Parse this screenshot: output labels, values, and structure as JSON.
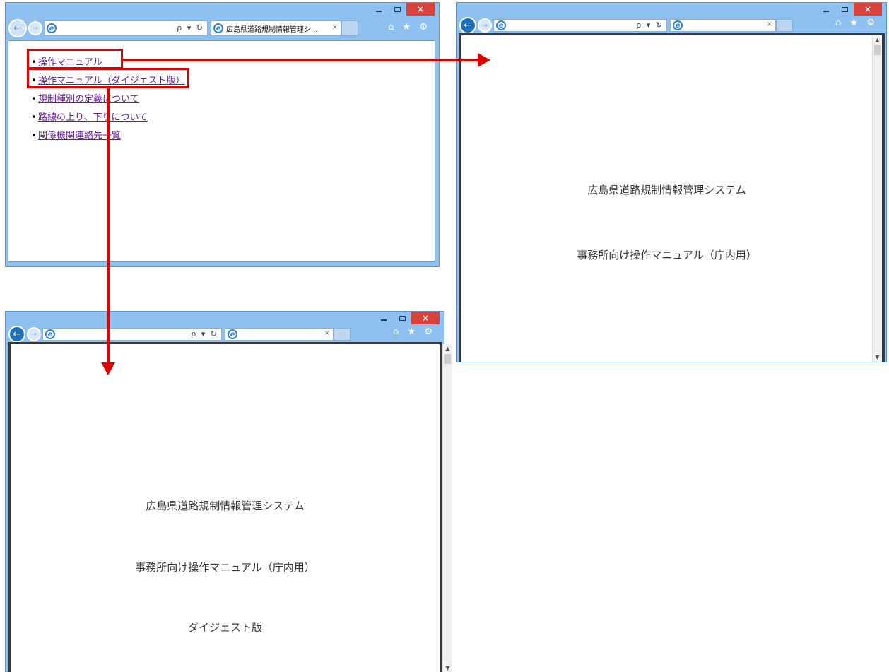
{
  "browser_main": {
    "tab_title": "広島県道路規制情報管理シ...",
    "tab_close": "×",
    "search_refresh": "ρ ▾ ↻",
    "links": [
      "操作マニュアル",
      "操作マニュアル（ダイジェスト版）",
      "規制種別の定義について",
      "路線の上り、下りについて",
      "関係機関連絡先一覧"
    ]
  },
  "browser_manual": {
    "tab_close": "×",
    "search_refresh": "ρ ▾ ↻",
    "doc_line1": "広島県道路規制情報管理システム",
    "doc_line2": "事務所向け操作マニュアル（庁内用）"
  },
  "browser_digest": {
    "tab_close": "×",
    "search_refresh": "ρ ▾ ↻",
    "doc_line1": "広島県道路規制情報管理システム",
    "doc_line2": "事務所向け操作マニュアル（庁内用）",
    "doc_line3": "ダイジェスト版"
  },
  "window_controls": {
    "close": "×"
  },
  "toolbar_icons": "⌂ ★ ⚙",
  "colors": {
    "chrome": "#8fc1f0",
    "highlight": "#e00000",
    "link": "#6a1a9e"
  }
}
